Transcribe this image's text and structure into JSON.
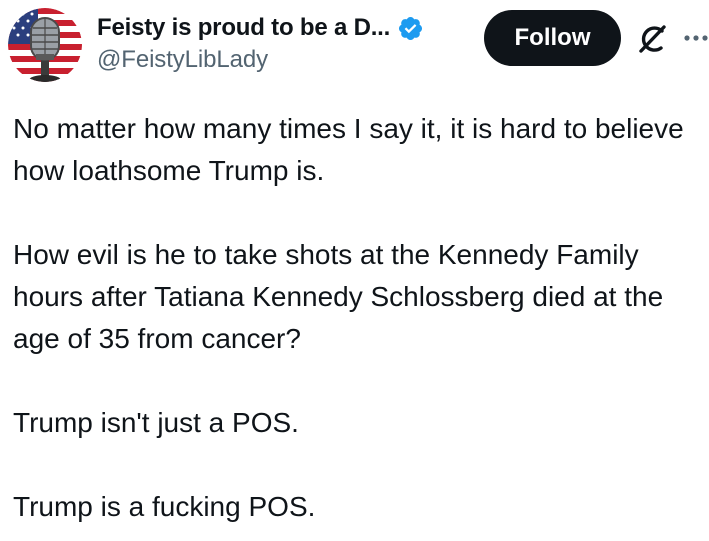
{
  "author": {
    "display_name": "Feisty is proud to be a D...",
    "handle": "@FeistyLibLady",
    "verified": true,
    "verified_badge_color": "#1d9bf0",
    "avatar_icon": "vintage-microphone-flag-avatar"
  },
  "actions": {
    "follow_label": "Follow",
    "grok_icon": "grok-icon",
    "more_icon": "more-dots-icon"
  },
  "tweet": {
    "paragraphs": [
      "No matter how many times I say it, it is hard to believe how loathsome Trump is.",
      "How evil is he to take shots at the Kennedy Family hours after Tatiana Kennedy Schlossberg died at the age of 35 from cancer?",
      "Trump isn't just a POS.",
      "Trump is a fucking POS."
    ]
  },
  "colors": {
    "text_primary": "#0f1419",
    "text_secondary": "#536471",
    "follow_button_bg": "#0f1419",
    "follow_button_text": "#ffffff"
  }
}
